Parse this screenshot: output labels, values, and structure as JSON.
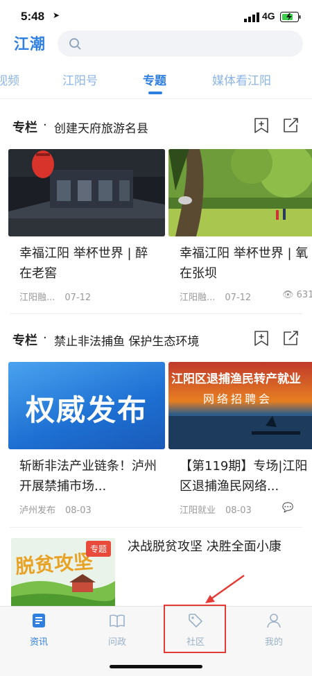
{
  "status_bar": {
    "time": "5:48",
    "network": "4G"
  },
  "header": {
    "logo": "江潮",
    "search_placeholder": ""
  },
  "tabs": [
    {
      "label": "视频"
    },
    {
      "label": "江阳号"
    },
    {
      "label": "专题",
      "active": true
    },
    {
      "label": "媒体看江阳"
    }
  ],
  "sections": [
    {
      "tag": "专栏",
      "title": "创建天府旅游名县",
      "cards": [
        {
          "title": "幸福江阳 举杯世界 | 醉在老窖",
          "source": "江阳融...",
          "date": "07-12",
          "stat": ""
        },
        {
          "title": "幸福江阳 举杯世界 | 氧在张坝",
          "source": "江阳融...",
          "date": "07-12",
          "stat": "631"
        }
      ]
    },
    {
      "tag": "专栏",
      "title": "禁止非法捕鱼 保护生态环境",
      "cards": [
        {
          "title": "斩断非法产业链条！泸州开展禁捕市场...",
          "source": "泸州发布",
          "date": "08-03",
          "stat": "",
          "img_text": "权威发布"
        },
        {
          "title": "【第119期】专场|江阳区退捕渔民网络...",
          "source": "江阳就业",
          "date": "08-03",
          "stat": "",
          "img_text_1": "江阳区退捕渔民转产就业",
          "img_text_2": "网络招聘会"
        }
      ]
    }
  ],
  "feature": {
    "badge": "专题",
    "img_text": "脱贫攻坚",
    "title": "决战脱贫攻坚 决胜全面小康"
  },
  "bottom_nav": [
    {
      "label": "资讯",
      "icon": "news-icon",
      "active": true
    },
    {
      "label": "问政",
      "icon": "book-icon"
    },
    {
      "label": "社区",
      "icon": "tag-icon"
    },
    {
      "label": "我的",
      "icon": "person-icon"
    }
  ],
  "colors": {
    "accent": "#2f7fe0",
    "highlight": "#e53935",
    "badge": "#e84b3c"
  }
}
